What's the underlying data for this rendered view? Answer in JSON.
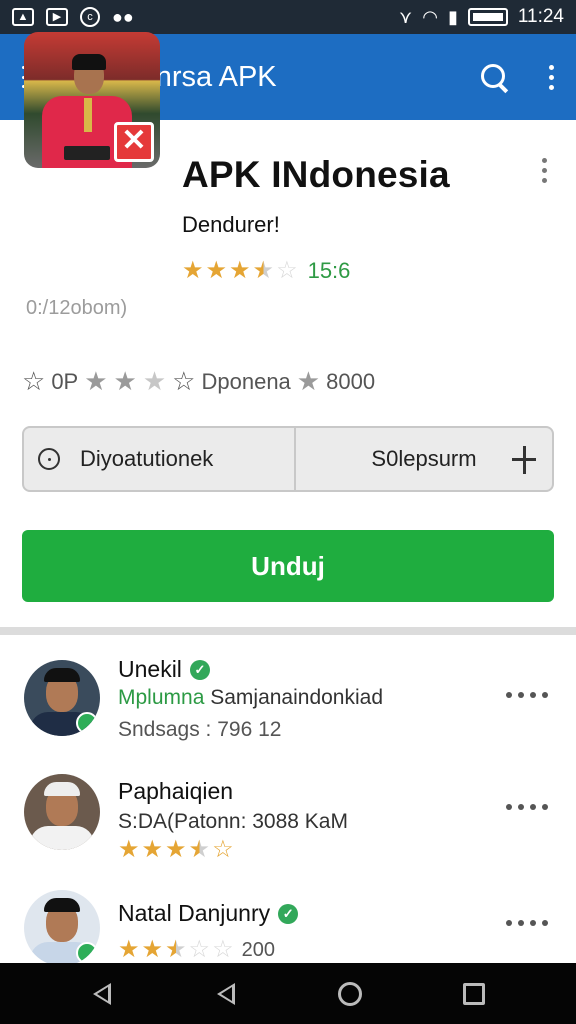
{
  "status_bar": {
    "icons": [
      "image-icon",
      "play-icon",
      "circle-app-icon",
      "gamepad-icon"
    ],
    "right_icons": [
      "vibrate-icon",
      "wifi-icon",
      "signal-icon",
      "battery-icon"
    ],
    "time": "11:24"
  },
  "app_bar": {
    "title": "Adoonrsa APK"
  },
  "app": {
    "title": "APK INdonesia",
    "developer": "Dendurer!",
    "rating_stars": 3.5,
    "rating_value": "15:6",
    "size": "0:/12obom)",
    "meta": {
      "label_1": "0P",
      "label_2": "Dponena",
      "label_3": "8000"
    },
    "button_left": "Diyoatutionek",
    "button_right": "S0lepsurm",
    "download_label": "Unduj"
  },
  "reviews": [
    {
      "name": "Unekil",
      "line1_green": "Mplumna",
      "line1_rest": "Samjanaindonkiad",
      "line2": "Sndsags : 796 12"
    },
    {
      "name": "Paphaiqien",
      "line1": "S:DA(Patonn: 3088 KaM",
      "stars": 3.5
    },
    {
      "name": "Natal Danjunry",
      "stars": 2.5,
      "rating_value": "200"
    }
  ],
  "colors": {
    "app_bar": "#1d6dc2",
    "download": "#1fad3f",
    "star": "#e5a534",
    "rating_green": "#2e9a44"
  }
}
